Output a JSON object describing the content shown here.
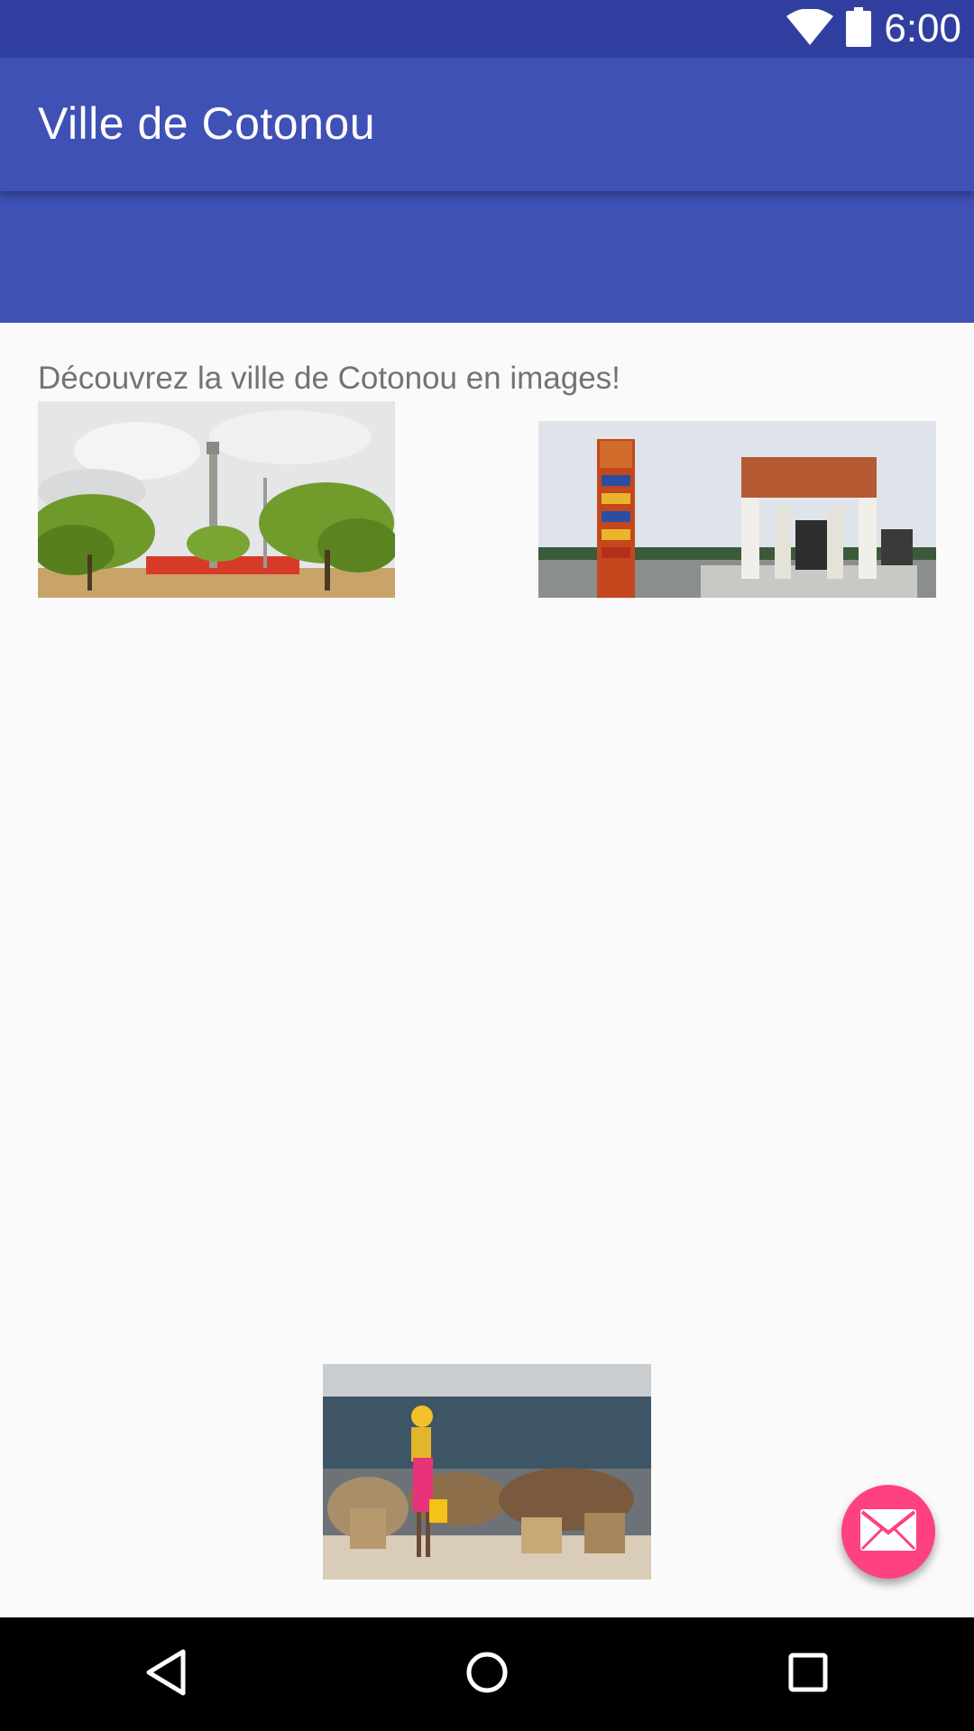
{
  "status_bar": {
    "time": "6:00",
    "icons": [
      "wifi-icon",
      "battery-icon"
    ],
    "background": "#303f9f"
  },
  "app_bar": {
    "title": "Ville de Cotonou",
    "background": "#3f51b5"
  },
  "content": {
    "intro": "Découvrez la ville de Cotonou en images!",
    "images": [
      {
        "name": "photo-monument-park"
      },
      {
        "name": "photo-door-of-no-return"
      },
      {
        "name": "photo-market-woman"
      }
    ]
  },
  "fab": {
    "icon": "mail-icon",
    "color": "#ff4081"
  },
  "nav_bar": {
    "buttons": [
      "back-icon",
      "home-icon",
      "recents-icon"
    ]
  }
}
